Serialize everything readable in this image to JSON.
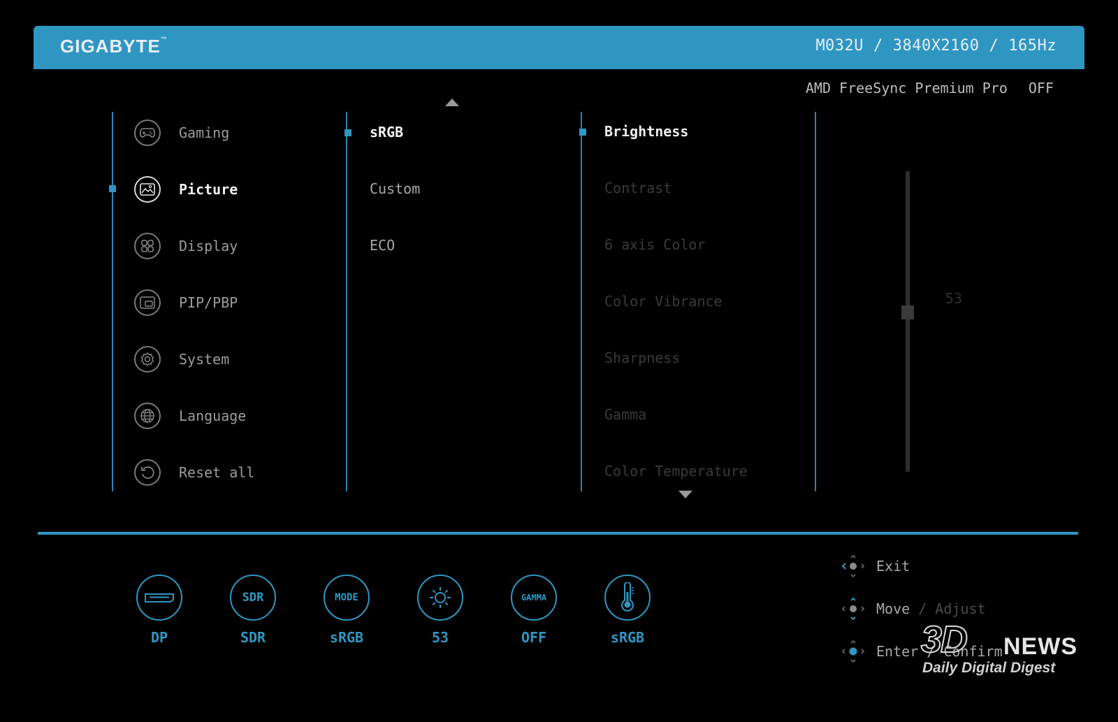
{
  "header": {
    "brand": "GIGABYTE",
    "brand_mark": "™",
    "model": "M032U",
    "resolution": "3840X2160",
    "refresh_rate": "165Hz",
    "separator": "/"
  },
  "freesync": {
    "label": "AMD FreeSync Premium Pro",
    "value": "OFF"
  },
  "main_menu": [
    {
      "label": "Gaming",
      "icon": "gamepad-icon"
    },
    {
      "label": "Picture",
      "icon": "picture-icon",
      "active": true
    },
    {
      "label": "Display",
      "icon": "display-grid-icon"
    },
    {
      "label": "PIP/PBP",
      "icon": "pip-icon"
    },
    {
      "label": "System",
      "icon": "gear-icon"
    },
    {
      "label": "Language",
      "icon": "globe-icon"
    },
    {
      "label": "Reset all",
      "icon": "reset-icon"
    }
  ],
  "picture_modes": [
    {
      "label": "sRGB",
      "active": true
    },
    {
      "label": "Custom"
    },
    {
      "label": "ECO"
    }
  ],
  "parameters": [
    {
      "label": "Brightness",
      "active": true
    },
    {
      "label": "Contrast"
    },
    {
      "label": "6 axis Color"
    },
    {
      "label": "Color Vibrance"
    },
    {
      "label": "Sharpness"
    },
    {
      "label": "Gamma"
    },
    {
      "label": "Color Temperature"
    }
  ],
  "slider": {
    "value": "53",
    "level": 0.53
  },
  "status_bar": [
    {
      "icon": "displayport-icon",
      "text": "",
      "label": "DP"
    },
    {
      "icon": "sdr-icon",
      "text": "SDR",
      "label": "SDR"
    },
    {
      "icon": "mode-icon",
      "text": "MODE",
      "label": "sRGB"
    },
    {
      "icon": "brightness-icon",
      "text": "",
      "label": "53"
    },
    {
      "icon": "gamma-icon",
      "text": "GAMMA",
      "label": "OFF"
    },
    {
      "icon": "thermometer-icon",
      "text": "",
      "label": "sRGB"
    }
  ],
  "hints": {
    "exit": "Exit",
    "move": "Move",
    "adjust": "/ Adjust",
    "enter": "Enter / Confirm"
  },
  "watermark": {
    "logo": "3D",
    "name": "NEWS",
    "tagline": "Daily Digital Digest"
  },
  "colors": {
    "accent": "#2f96c2",
    "background": "#000000"
  }
}
